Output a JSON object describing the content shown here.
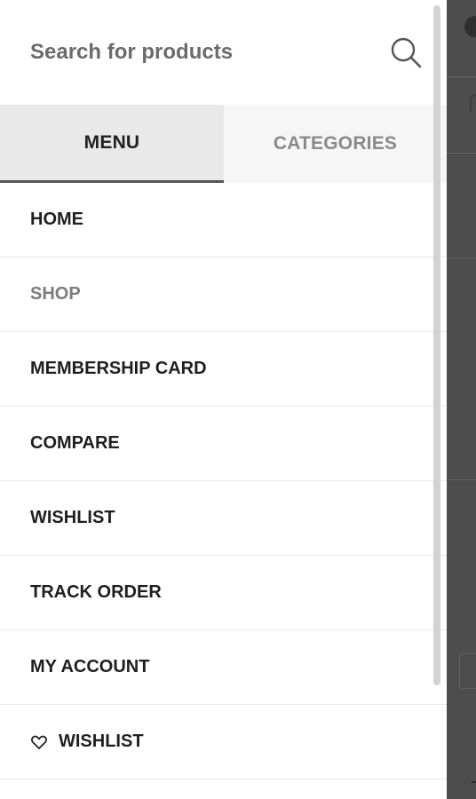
{
  "search": {
    "placeholder": "Search for products",
    "icon": "search-icon"
  },
  "tabs": [
    {
      "label": "MENU",
      "active": true
    },
    {
      "label": "CATEGORIES",
      "active": false
    }
  ],
  "menu": {
    "items": [
      {
        "label": "HOME"
      },
      {
        "label": "SHOP"
      },
      {
        "label": "MEMBERSHIP CARD"
      },
      {
        "label": "COMPARE"
      },
      {
        "label": "WISHLIST"
      },
      {
        "label": "TRACK ORDER"
      },
      {
        "label": "MY ACCOUNT"
      },
      {
        "label": "WISHLIST",
        "icon": "heart-icon"
      }
    ]
  },
  "colors": {
    "active_tab_bg": "#e9e9e9",
    "inactive_tab_bg": "#f6f6f6",
    "overlay": "#4d4d4d"
  }
}
